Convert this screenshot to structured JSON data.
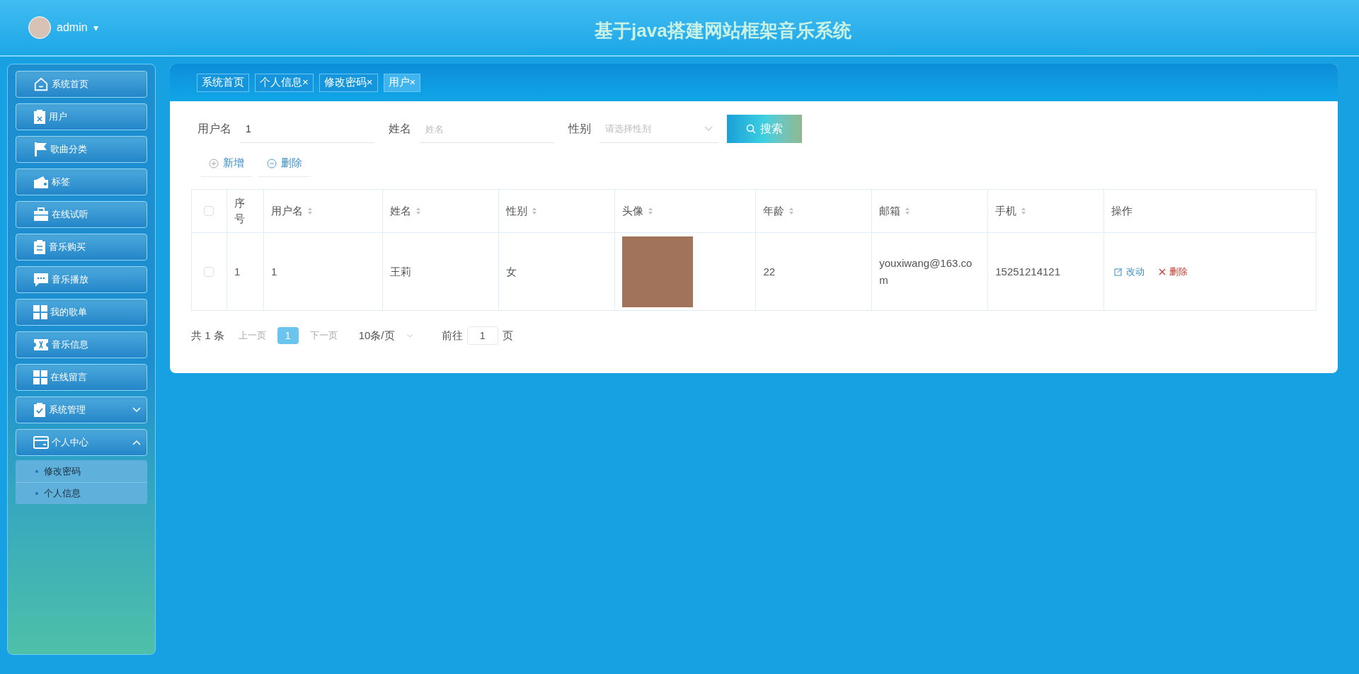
{
  "header": {
    "user": "admin",
    "caret": "▾",
    "title": "基于java搭建网站框架音乐系统"
  },
  "sidebar": {
    "items": [
      {
        "label": "系统首页"
      },
      {
        "label": "用户"
      },
      {
        "label": "歌曲分类"
      },
      {
        "label": "标签"
      },
      {
        "label": "在线试听"
      },
      {
        "label": "音乐购买"
      },
      {
        "label": "音乐播放"
      },
      {
        "label": "我的歌单"
      },
      {
        "label": "音乐信息"
      },
      {
        "label": "在线留言"
      },
      {
        "label": "系统管理",
        "expanded": false
      },
      {
        "label": "个人中心",
        "expanded": true,
        "children": [
          {
            "label": "修改密码"
          },
          {
            "label": "个人信息"
          }
        ]
      }
    ]
  },
  "tabs": [
    {
      "label": "系统首页",
      "selected": false
    },
    {
      "label": "个人信息",
      "close": "×",
      "selected": false
    },
    {
      "label": "修改密码",
      "close": "×",
      "selected": false
    },
    {
      "label": "用户",
      "close": "×",
      "selected": true
    }
  ],
  "search": {
    "fields": [
      {
        "label": "用户名",
        "kind": "input",
        "value": "1"
      },
      {
        "label": "姓名",
        "kind": "input",
        "placeholder": "姓名"
      },
      {
        "label": "性别",
        "kind": "select",
        "placeholder": "请选择性别"
      }
    ],
    "button": "搜索"
  },
  "actions": [
    {
      "kind": "add",
      "label": "新增"
    },
    {
      "kind": "delete",
      "label": "删除"
    }
  ],
  "table": {
    "all_checked": false,
    "columns": [
      {
        "label": "序号",
        "sortable": false
      },
      {
        "label": "用户名",
        "sortable": true
      },
      {
        "label": "姓名",
        "sortable": true
      },
      {
        "label": "性别",
        "sortable": true
      },
      {
        "label": "头像",
        "sortable": true
      },
      {
        "label": "年龄",
        "sortable": true
      },
      {
        "label": "邮箱",
        "sortable": true
      },
      {
        "label": "手机",
        "sortable": true
      },
      {
        "label": "操作",
        "sortable": false
      }
    ],
    "rows": [
      {
        "checked": false,
        "cells": [
          "1",
          "1",
          "王莉",
          "女",
          null,
          "22",
          "youxiwang@163.com",
          "15251214121"
        ],
        "actions": [
          {
            "kind": "edit",
            "label": "改动"
          },
          {
            "kind": "delete",
            "label": "删除"
          }
        ]
      }
    ]
  },
  "pagination": {
    "total": "共 1 条",
    "prev": "上一页",
    "pages": [
      {
        "label": "1",
        "selected": true
      }
    ],
    "next": "下一页",
    "size": "10条/页",
    "goto": "前往",
    "page": "1",
    "unit": "页"
  }
}
